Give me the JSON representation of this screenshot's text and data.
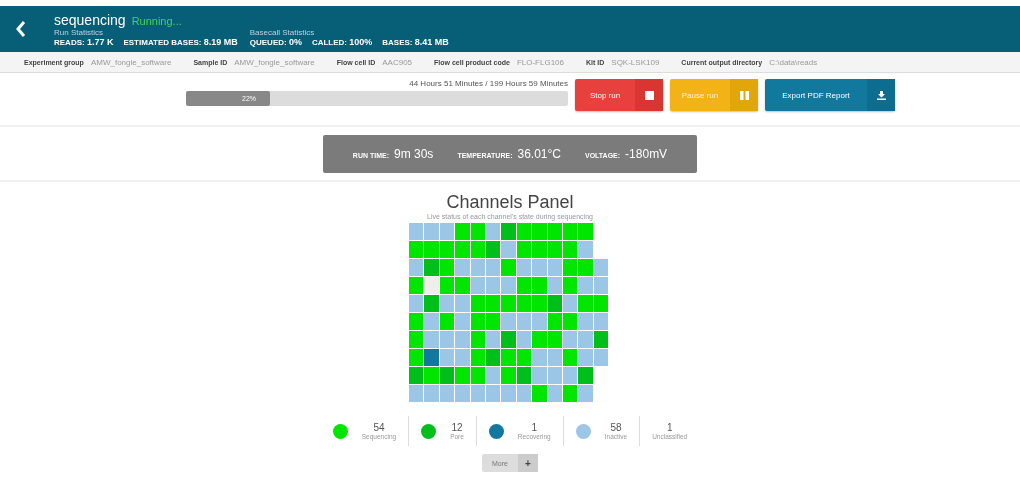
{
  "header": {
    "title": "sequencing",
    "status": "Running...",
    "groups": [
      {
        "caption": "Run Statistics",
        "stats": [
          {
            "label": "READS:",
            "value": "1.77 K"
          },
          {
            "label": "ESTIMATED BASES:",
            "value": "8.19 MB"
          }
        ]
      },
      {
        "caption": "Basecall Statistics",
        "stats": [
          {
            "label": "QUEUED:",
            "value": "0%"
          },
          {
            "label": "CALLED:",
            "value": "100%"
          },
          {
            "label": "BASES:",
            "value": "8.41 MB"
          }
        ]
      }
    ]
  },
  "info": [
    {
      "label": "Experiment group",
      "value": "AMW_fongle_software"
    },
    {
      "label": "Sample ID",
      "value": "AMW_fongle_software"
    },
    {
      "label": "Flow cell ID",
      "value": "AAC905"
    },
    {
      "label": "Flow cell product code",
      "value": "FLO-FLG106"
    },
    {
      "label": "Kit ID",
      "value": "SQK-LSK109"
    },
    {
      "label": "Current output directory",
      "value": "C:\\data\\reads"
    }
  ],
  "progress": {
    "time": "44 Hours 51 Minutes / 199 Hours 59 Minutes",
    "label": "22%",
    "level": 0.22
  },
  "buttons": [
    {
      "kind": "stop",
      "label": "Stop run"
    },
    {
      "kind": "pause",
      "label": "Pause run"
    },
    {
      "kind": "export",
      "label": "Export PDF Report"
    }
  ],
  "readings": [
    {
      "label": "RUN TIME:",
      "value": "9m 30s"
    },
    {
      "label": "TEMPERATURE:",
      "value": "36.01°C"
    },
    {
      "label": "VOLTAGE:",
      "value": "-180mV"
    }
  ],
  "panel": {
    "title": "Channels Panel",
    "subtitle": "Live status of each channel's state during sequencing",
    "grid": [
      {
        "cells": [
          {
            "color": "#9cc6e6"
          },
          {
            "color": "#9cc6e6"
          },
          {
            "color": "#9cc6e6"
          },
          {
            "color": "#00e600"
          },
          {
            "color": "#00e600"
          },
          {
            "color": "#9cc6e6"
          },
          {
            "color": "#00bf1a"
          },
          {
            "color": "#00e600"
          },
          {
            "color": "#00e600"
          },
          {
            "color": "#00e600"
          },
          {
            "color": "#00e600"
          },
          {
            "color": "#00e600"
          }
        ]
      },
      {
        "cells": [
          {
            "color": "#00e600"
          },
          {
            "color": "#00e600"
          },
          {
            "color": "#00e600"
          },
          {
            "color": "#00e600"
          },
          {
            "color": "#00e600"
          },
          {
            "color": "#00bf1a"
          },
          {
            "color": "#9cc6e6"
          },
          {
            "color": "#00e600"
          },
          {
            "color": "#00e600"
          },
          {
            "color": "#00e600"
          },
          {
            "color": "#00e600"
          },
          {
            "color": "#9cc6e6"
          }
        ]
      },
      {
        "cells": [
          {
            "color": "#9cc6e6"
          },
          {
            "color": "#00bf1a"
          },
          {
            "color": "#00e600"
          },
          {
            "color": "#9cc6e6"
          },
          {
            "color": "#9cc6e6"
          },
          {
            "color": "#9cc6e6"
          },
          {
            "color": "#00e600"
          },
          {
            "color": "#9cc6e6"
          },
          {
            "color": "#9cc6e6"
          },
          {
            "color": "#9cc6e6"
          },
          {
            "color": "#00e600"
          },
          {
            "color": "#00e600"
          },
          {
            "color": "#9cc6e6"
          }
        ]
      },
      {
        "cells": [
          {
            "color": "#00e600"
          },
          {
            "color": "#eeeeea"
          },
          {
            "color": "#00e600"
          },
          {
            "color": "#00e600"
          },
          {
            "color": "#9cc6e6"
          },
          {
            "color": "#9cc6e6"
          },
          {
            "color": "#9cc6e6"
          },
          {
            "color": "#00e600"
          },
          {
            "color": "#00e600"
          },
          {
            "color": "#9cc6e6"
          },
          {
            "color": "#00e600"
          },
          {
            "color": "#9cc6e6"
          },
          {
            "color": "#9cc6e6"
          }
        ]
      },
      {
        "cells": [
          {
            "color": "#9cc6e6"
          },
          {
            "color": "#00bf1a"
          },
          {
            "color": "#9cc6e6"
          },
          {
            "color": "#9cc6e6"
          },
          {
            "color": "#00e600"
          },
          {
            "color": "#00e600"
          },
          {
            "color": "#00e600"
          },
          {
            "color": "#00e600"
          },
          {
            "color": "#00e600"
          },
          {
            "color": "#00bf1a"
          },
          {
            "color": "#9cc6e6"
          },
          {
            "color": "#00e600"
          },
          {
            "color": "#00e600"
          }
        ]
      },
      {
        "cells": [
          {
            "color": "#00e600"
          },
          {
            "color": "#9cc6e6"
          },
          {
            "color": "#00e600"
          },
          {
            "color": "#9cc6e6"
          },
          {
            "color": "#00e600"
          },
          {
            "color": "#00e600"
          },
          {
            "color": "#9cc6e6"
          },
          {
            "color": "#9cc6e6"
          },
          {
            "color": "#9cc6e6"
          },
          {
            "color": "#00e600"
          },
          {
            "color": "#00e600"
          },
          {
            "color": "#9cc6e6"
          },
          {
            "color": "#9cc6e6"
          }
        ]
      },
      {
        "cells": [
          {
            "color": "#00e600"
          },
          {
            "color": "#9cc6e6"
          },
          {
            "color": "#9cc6e6"
          },
          {
            "color": "#9cc6e6"
          },
          {
            "color": "#00e600"
          },
          {
            "color": "#9cc6e6"
          },
          {
            "color": "#00bf1a"
          },
          {
            "color": "#9cc6e6"
          },
          {
            "color": "#00e600"
          },
          {
            "color": "#00e600"
          },
          {
            "color": "#9cc6e6"
          },
          {
            "color": "#9cc6e6"
          },
          {
            "color": "#00bf1a"
          }
        ]
      },
      {
        "cells": [
          {
            "color": "#00e600"
          },
          {
            "color": "#1278a0"
          },
          {
            "color": "#9cc6e6"
          },
          {
            "color": "#9cc6e6"
          },
          {
            "color": "#00e600"
          },
          {
            "color": "#00bf1a"
          },
          {
            "color": "#00e600"
          },
          {
            "color": "#00e600"
          },
          {
            "color": "#9cc6e6"
          },
          {
            "color": "#9cc6e6"
          },
          {
            "color": "#00e600"
          },
          {
            "color": "#9cc6e6"
          },
          {
            "color": "#9cc6e6"
          }
        ]
      },
      {
        "cells": [
          {
            "color": "#00bf1a"
          },
          {
            "color": "#00e600"
          },
          {
            "color": "#00bf1a"
          },
          {
            "color": "#00e600"
          },
          {
            "color": "#00e600"
          },
          {
            "color": "#9cc6e6"
          },
          {
            "color": "#00e600"
          },
          {
            "color": "#00bf1a"
          },
          {
            "color": "#9cc6e6"
          },
          {
            "color": "#9cc6e6"
          },
          {
            "color": "#9cc6e6"
          },
          {
            "color": "#00bf1a"
          }
        ]
      },
      {
        "cells": [
          {
            "color": "#9cc6e6"
          },
          {
            "color": "#9cc6e6"
          },
          {
            "color": "#9cc6e6"
          },
          {
            "color": "#9cc6e6"
          },
          {
            "color": "#9cc6e6"
          },
          {
            "color": "#9cc6e6"
          },
          {
            "color": "#9cc6e6"
          },
          {
            "color": "#9cc6e6"
          },
          {
            "color": "#00e600"
          },
          {
            "color": "#9cc6e6"
          },
          {
            "color": "#00e600"
          },
          {
            "color": "#9cc6e6"
          }
        ]
      }
    ],
    "legend": [
      {
        "count": "54",
        "label": "Sequencing",
        "color": "#00e600"
      },
      {
        "count": "12",
        "label": "Pore",
        "color": "#00bf1a"
      },
      {
        "count": "1",
        "label": "Recovering",
        "color": "#1278a0"
      },
      {
        "count": "58",
        "label": "Inactive",
        "color": "#9cc6e6"
      },
      {
        "count": "1",
        "label": "Unclassified"
      }
    ],
    "more": {
      "label": "More",
      "icon": "+"
    }
  }
}
